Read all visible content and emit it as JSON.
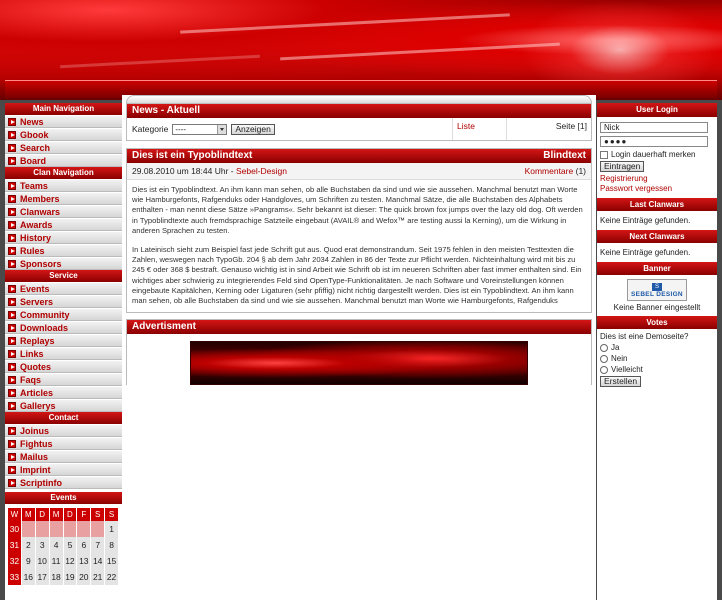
{
  "left": {
    "main_nav": {
      "title": "Main Navigation",
      "items": [
        "News",
        "Gbook",
        "Search",
        "Board"
      ]
    },
    "clan_nav": {
      "title": "Clan Navigation",
      "items": [
        "Teams",
        "Members",
        "Clanwars",
        "Awards",
        "History",
        "Rules",
        "Sponsors"
      ]
    },
    "service": {
      "title": "Service",
      "items": [
        "Events",
        "Servers",
        "Community",
        "Downloads",
        "Replays",
        "Links",
        "Quotes",
        "Faqs",
        "Articles",
        "Gallerys"
      ]
    },
    "contact": {
      "title": "Contact",
      "items": [
        "Joinus",
        "Fightus",
        "Mailus",
        "Imprint",
        "Scriptinfo"
      ]
    },
    "events": {
      "title": "Events",
      "weekdays": [
        "W",
        "M",
        "D",
        "M",
        "D",
        "F",
        "S",
        "S"
      ],
      "rows": [
        [
          "30",
          "",
          "",
          "",
          "",
          "",
          "",
          "1"
        ],
        [
          "31",
          "2",
          "3",
          "4",
          "5",
          "6",
          "7",
          "8"
        ],
        [
          "32",
          "9",
          "10",
          "11",
          "12",
          "13",
          "14",
          "15"
        ],
        [
          "33",
          "16",
          "17",
          "18",
          "19",
          "20",
          "21",
          "22"
        ]
      ]
    }
  },
  "news": {
    "title": "News - Aktuell",
    "category_label": "Kategorie",
    "category_value": "----",
    "show_button": "Anzeigen",
    "list_link": "Liste",
    "page_label": "Seite [1]"
  },
  "article": {
    "title": "Dies ist ein Typoblindtext",
    "tag": "Blindtext",
    "date": "29.08.2010 um 18:44 Uhr - ",
    "author": "Sebel-Design",
    "comments": "Kommentare",
    "comments_count": "(1)",
    "paragraph1": "Dies ist ein Typoblindtext. An ihm kann man sehen, ob alle Buchstaben da sind und wie sie aussehen. Manchmal benutzt man Worte wie Hamburgefonts, Rafgenduks oder Handgloves, um Schriften zu testen. Manchmal Sätze, die alle Buchstaben des Alphabets enthalten - man nennt diese Sätze »Pangrams«. Sehr bekannt ist dieser: The quick brown fox jumps over the lazy old dog. Oft werden in Typoblindtexte auch fremdsprachige Satzteile eingebaut (AVAIL® and Wefox™ are testing aussi la Kerning), um die Wirkung in anderen Sprachen zu testen.",
    "paragraph2": "In Lateinisch sieht zum Beispiel fast jede Schrift gut aus. Quod erat demonstrandum. Seit 1975 fehlen in den meisten Testtexten die Zahlen, weswegen nach TypoGb. 204 § ab dem Jahr 2034 Zahlen in 86 der Texte zur Pflicht werden. Nichteinhaltung wird mit bis zu 245 € oder 368 $ bestraft. Genauso wichtig ist in sind Arbeit wie Schrift ob ist im neueren Schriften aber fast immer enthalten sind. Ein wichtiges aber schwierig zu integrierendes Feld sind OpenType-Funktionalitäten. Je nach Software und Voreinstellungen können eingebaute Kapitälchen, Kerning oder Ligaturen (sehr pfiffig) nicht richtig dargestellt werden. Dies ist ein Typoblindtext. An ihm kann man sehen, ob alle Buchstaben da sind und wie sie aussehen. Manchmal benutzt man Worte wie Hamburgefonts, Rafgenduks"
  },
  "advertisment": {
    "title": "Advertisment"
  },
  "right": {
    "login": {
      "title": "User Login",
      "username": "Nick",
      "password_mask": "●●●●",
      "remember_label": "Login dauerhaft merken",
      "submit": "Eintragen",
      "register": "Registrierung",
      "forgot": "Passwort vergessen"
    },
    "last_clanwars": {
      "title": "Last Clanwars",
      "text": "Keine Einträge gefunden."
    },
    "next_clanwars": {
      "title": "Next Clanwars",
      "text": "Keine Einträge gefunden."
    },
    "banner": {
      "title": "Banner",
      "logo_text": "SEBEL DESIGN",
      "text": "Keine Banner eingestellt"
    },
    "votes": {
      "title": "Votes",
      "question": "Dies ist eine Demoseite?",
      "options": [
        "Ja",
        "Nein",
        "Vielleicht"
      ],
      "submit": "Erstellen"
    }
  }
}
